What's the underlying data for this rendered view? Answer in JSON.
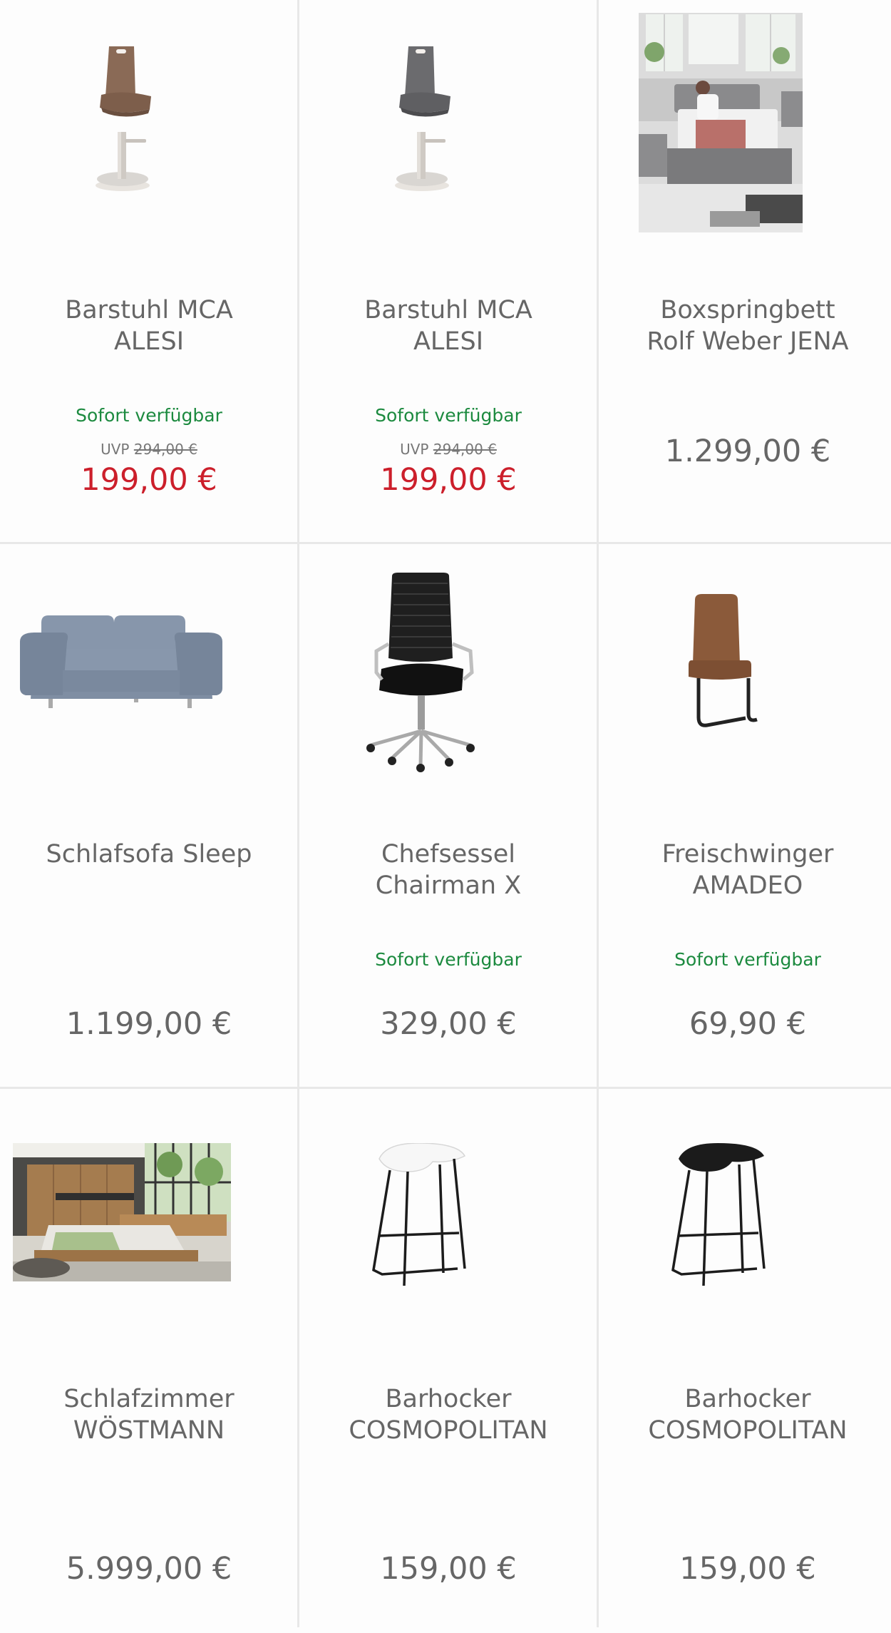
{
  "products": [
    {
      "name_line1": "Barstuhl MCA",
      "name_line2": "ALESI",
      "image": "brown-bar-stool",
      "availability": "Sofort verfügbar",
      "uvp_label": "UVP",
      "uvp_price": "294,00 €",
      "price": "199,00 €"
    },
    {
      "name_line1": "Barstuhl MCA",
      "name_line2": "ALESI",
      "image": "grey-bar-stool",
      "availability": "Sofort verfügbar",
      "uvp_label": "UVP",
      "uvp_price": "294,00 €",
      "price": "199,00 €"
    },
    {
      "name_line1": "Boxspringbett",
      "name_line2": "Rolf Weber JENA",
      "image": "boxspring-bed-room-photo",
      "price": "1.299,00 €"
    },
    {
      "name_line1": "Schlafsofa Sleep",
      "name_line2": "",
      "image": "blue-grey-sofa",
      "price": "1.199,00 €"
    },
    {
      "name_line1": "Chefsessel",
      "name_line2": "Chairman X",
      "image": "black-office-chair",
      "availability": "Sofort verfügbar",
      "price": "329,00 €"
    },
    {
      "name_line1": "Freischwinger",
      "name_line2": "AMADEO",
      "image": "brown-cantilever-chair",
      "availability": "Sofort verfügbar",
      "price": "69,90 €"
    },
    {
      "name_line1": "Schlafzimmer",
      "name_line2": "WÖSTMANN",
      "image": "bedroom-photo",
      "price": "5.999,00 €"
    },
    {
      "name_line1": "Barhocker",
      "name_line2": "COSMOPOLITAN",
      "image": "white-bar-stool",
      "price": "159,00 €"
    },
    {
      "name_line1": "Barhocker",
      "name_line2": "COSMOPOLITAN",
      "image": "black-bar-stool",
      "price": "159,00 €"
    }
  ],
  "colors": {
    "availability": "#1c8a3f",
    "sale_price": "#cc1f2b",
    "regular_price": "#666666"
  }
}
